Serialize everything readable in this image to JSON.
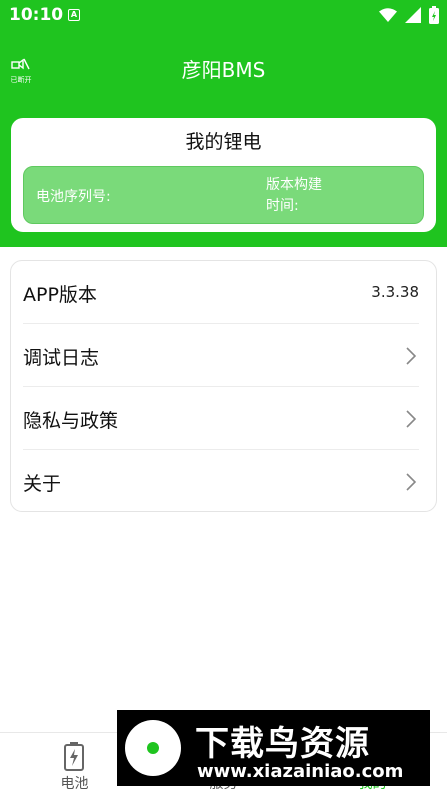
{
  "status_bar": {
    "time": "10:10",
    "notification_glyph": "A"
  },
  "header": {
    "connection_label": "已断开",
    "title": "彦阳BMS"
  },
  "battery_card": {
    "title": "我的锂电",
    "serial_label": "电池序列号:",
    "build_time_label": "版本构建时间:"
  },
  "menu": {
    "items": [
      {
        "label": "APP版本",
        "value": "3.3.38"
      },
      {
        "label": "调试日志"
      },
      {
        "label": "隐私与政策"
      },
      {
        "label": "关于"
      }
    ]
  },
  "tabs": [
    {
      "label": "电池",
      "icon": "battery-icon",
      "active": false
    },
    {
      "label": "服务",
      "icon": "service-icon",
      "active": false
    },
    {
      "label": "我的",
      "icon": "profile-icon",
      "active": true
    }
  ],
  "watermark": {
    "title": "下载鸟资源",
    "url": "www.xiazainiao.com"
  },
  "colors": {
    "brand_green": "#1fc41f",
    "info_box": "#7ada7a"
  }
}
